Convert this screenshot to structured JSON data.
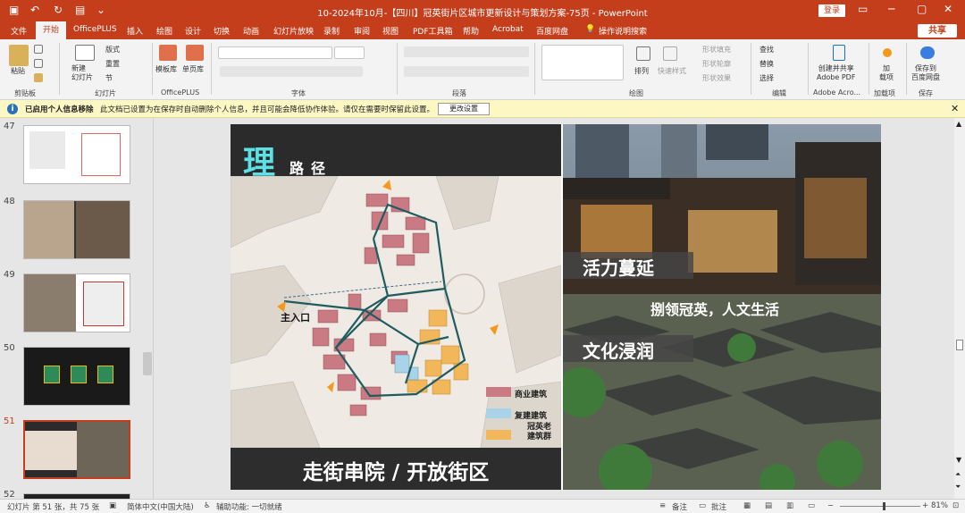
{
  "titlebar": {
    "doc_title": "10-2024年10月-【四川】冠英街片区城市更新设计与策划方案-75页 - PowerPoint",
    "login": "登录"
  },
  "tabs": [
    "文件",
    "开始",
    "OfficePLUS",
    "插入",
    "绘图",
    "设计",
    "切换",
    "动画",
    "幻灯片放映",
    "录制",
    "审阅",
    "视图",
    "PDF工具箱",
    "帮助",
    "Acrobat",
    "百度网盘"
  ],
  "active_tab": "开始",
  "tell_me": "操作说明搜索",
  "share": "共享",
  "ribbon": {
    "paste": "粘贴",
    "clipboard": "剪贴板",
    "new_slide": "新建\n幻灯片",
    "layout": "版式",
    "reset": "重置",
    "section": "节",
    "slides_group": "幻灯片",
    "template": "模板库",
    "single": "单页库",
    "officeplus_group": "OfficePLUS",
    "font_group": "字体",
    "paragraph_group": "段落",
    "arrange": "排列",
    "quick_styles": "快速样式",
    "shape_fill": "形状填充",
    "shape_outline": "形状轮廓",
    "shape_effects": "形状效果",
    "drawing_group": "绘图",
    "find": "查找",
    "replace": "替换",
    "select": "选择",
    "editing_group": "编辑",
    "create_pdf": "创建并共享\nAdobe PDF",
    "adobe_group": "Adobe Acro...",
    "addins": "加\n载项",
    "addins_group": "加载项",
    "save_baidu": "保存到\n百度网盘",
    "save_group": "保存"
  },
  "infobar": {
    "title": "已启用个人信息移除",
    "message": "此文档已设置为在保存时自动删除个人信息，并且可能会降低协作体验。请仅在需要时保留此设置。",
    "button": "更改设置"
  },
  "thumbnails": [
    "47",
    "48",
    "49",
    "50",
    "51",
    "52"
  ],
  "selected_thumb": "51",
  "slide": {
    "big_char": "理",
    "subtitle": "路径",
    "entrance": "主入口",
    "legend": [
      "商业建筑",
      "复建建筑",
      "冠英老\n建筑群"
    ],
    "band1": "活力蔓延",
    "slogan": "捌领冠英，人文生活",
    "band2": "文化浸润",
    "footer": "走街串院 / 开放街区"
  },
  "status": {
    "slide_info": "幻灯片 第 51 张，共 75 张",
    "language": "简体中文(中国大陆)",
    "accessibility": "辅助功能: 一切就绪",
    "notes": "备注",
    "comments": "批注",
    "zoom": "81%"
  },
  "colors": {
    "accent": "#c43e1c",
    "commercial": "#c97a82",
    "rebuilt": "#a8d3e8",
    "old": "#f2b75a",
    "path": "#1f5c5f"
  }
}
